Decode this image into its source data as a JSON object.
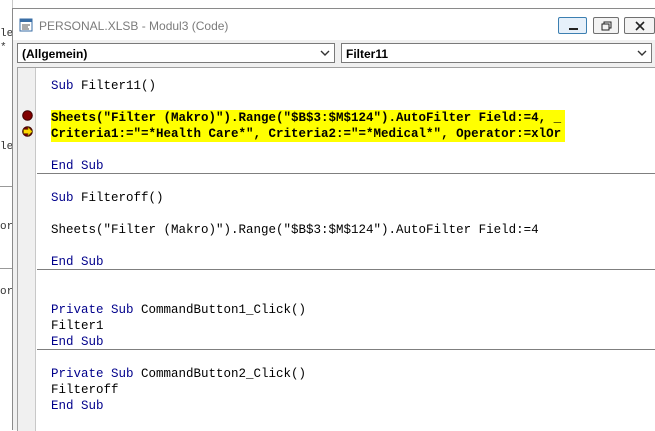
{
  "background_window": {
    "fragments": [
      "le",
      "*",
      "le",
      "or",
      "or"
    ]
  },
  "window": {
    "title": "PERSONAL.XLSB - Modul3 (Code)",
    "object_combo": "(Allgemein)",
    "procedure_combo": "Filter11"
  },
  "code": {
    "l1_kw": "Sub",
    "l1_rest": " Filter11()",
    "l2": "Sheets(\"Filter (Makro)\").Range(\"$B$3:$M$124\").AutoFilter Field:=4, _",
    "l3": "Criteria1:=\"=*Health Care*\", Criteria2:=\"=*Medical*\", Operator:=xlOr",
    "l4": "End Sub",
    "l5_kw": "Sub",
    "l5_rest": " Filteroff()",
    "l6": "Sheets(\"Filter (Makro)\").Range(\"$B$3:$M$124\").AutoFilter Field:=4",
    "l7": "End Sub",
    "l8_kw": "Private Sub",
    "l8_rest": " CommandButton1_Click()",
    "l9": "Filter1",
    "l10": "End Sub",
    "l11_kw": "Private Sub",
    "l11_rest": " CommandButton2_Click()",
    "l12": "Filteroff",
    "l13": "End Sub"
  },
  "colors": {
    "keyword": "#00008b",
    "highlight": "#ffff00",
    "breakpoint": "#800000",
    "execution_arrow": "#ffd700"
  },
  "icons": {
    "breakpoint": "breakpoint-icon",
    "current_line": "execution-arrow-icon"
  }
}
